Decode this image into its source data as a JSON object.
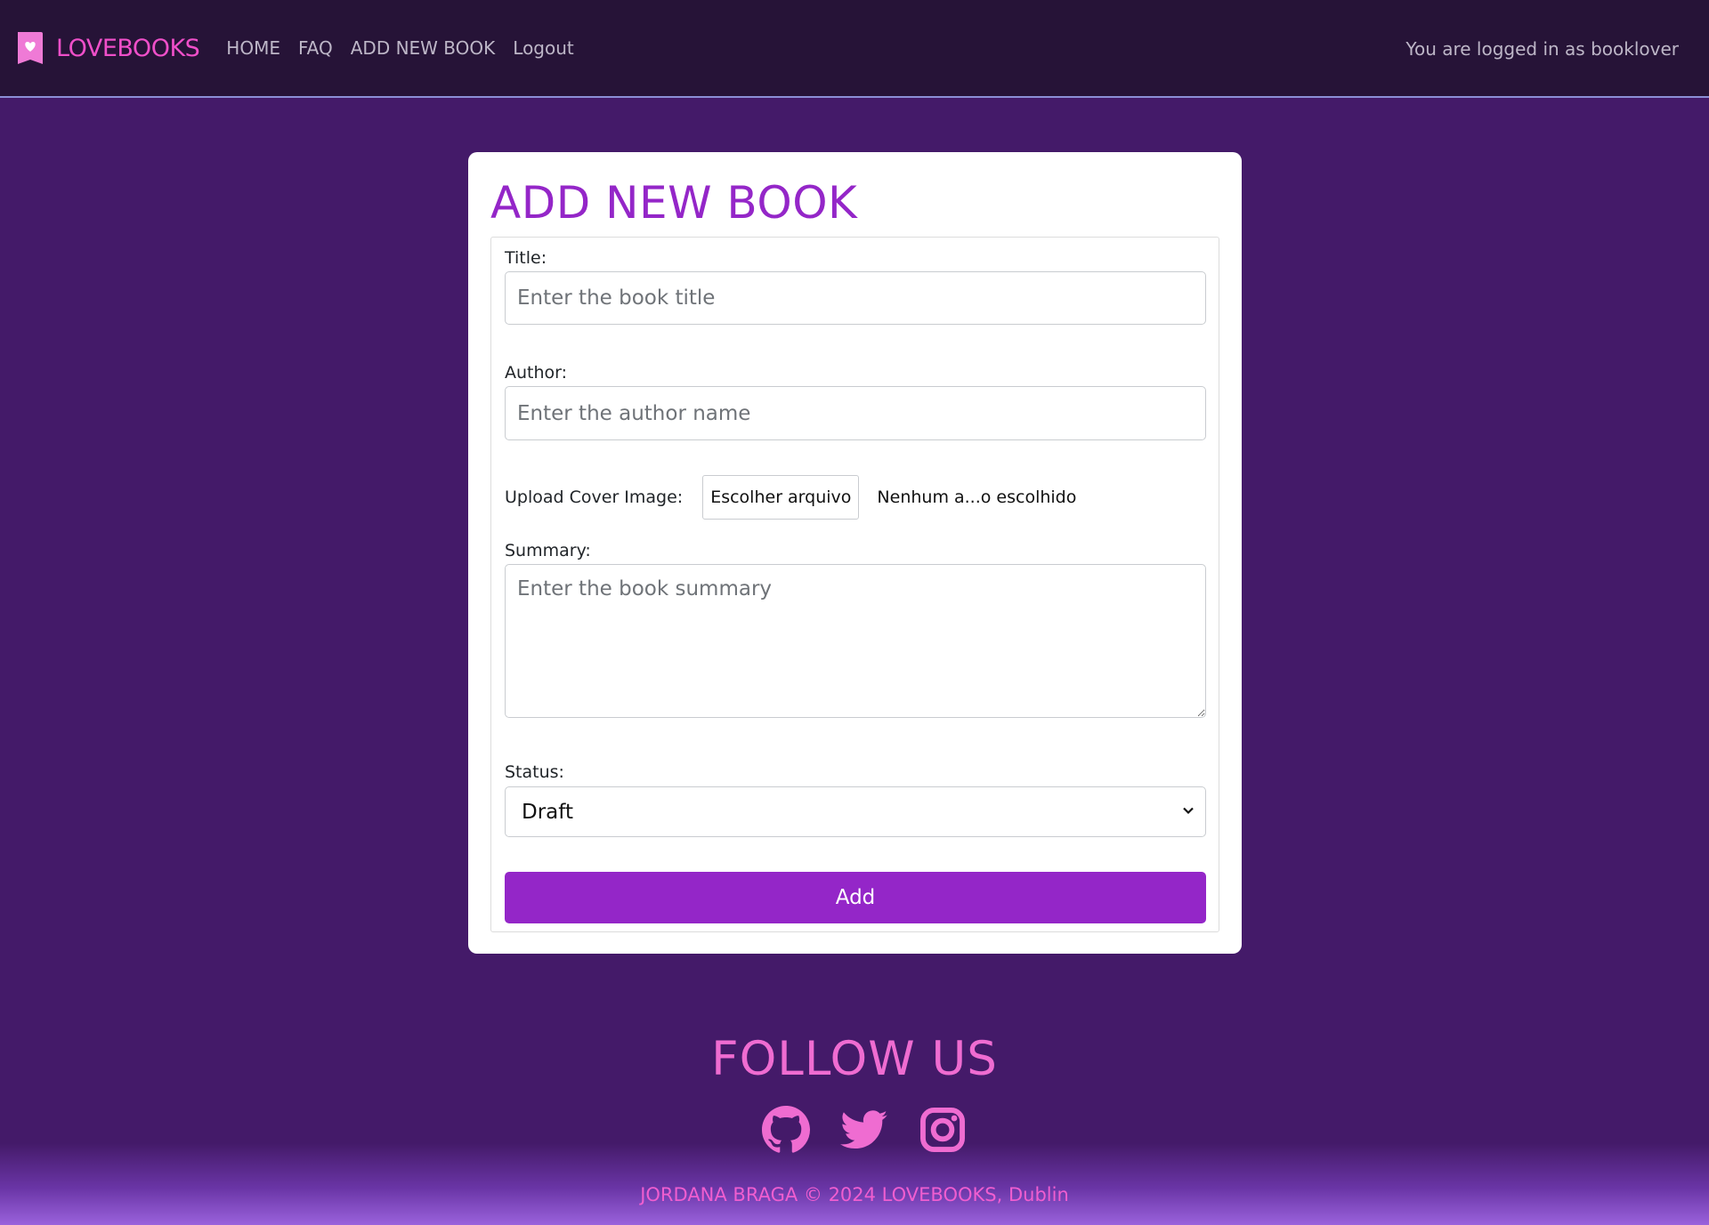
{
  "navbar": {
    "brand": "LOVEBOOKS",
    "links": [
      "HOME",
      "FAQ",
      "ADD NEW BOOK",
      "Logout"
    ],
    "user_text": "You are logged in as booklover"
  },
  "form": {
    "heading": "ADD NEW BOOK",
    "title_label": "Title:",
    "title_placeholder": "Enter the book title",
    "author_label": "Author:",
    "author_placeholder": "Enter the author name",
    "cover_label": "Upload Cover Image:",
    "file_button": "Escolher arquivo",
    "file_status": "Nenhum a...o escolhido",
    "summary_label": "Summary:",
    "summary_placeholder": "Enter the book summary",
    "status_label": "Status:",
    "status_value": "Draft",
    "submit_label": "Add"
  },
  "footer": {
    "follow_heading": "FOLLOW US",
    "social_icons": [
      "github-icon",
      "twitter-icon",
      "instagram-icon"
    ],
    "copyright": "JORDANA BRAGA © 2024 LOVEBOOKS, Dublin"
  },
  "colors": {
    "background": "#441a69",
    "navbar": "#261337",
    "brand_pink": "#ef4fc9",
    "accent_purple": "#9426c8"
  }
}
